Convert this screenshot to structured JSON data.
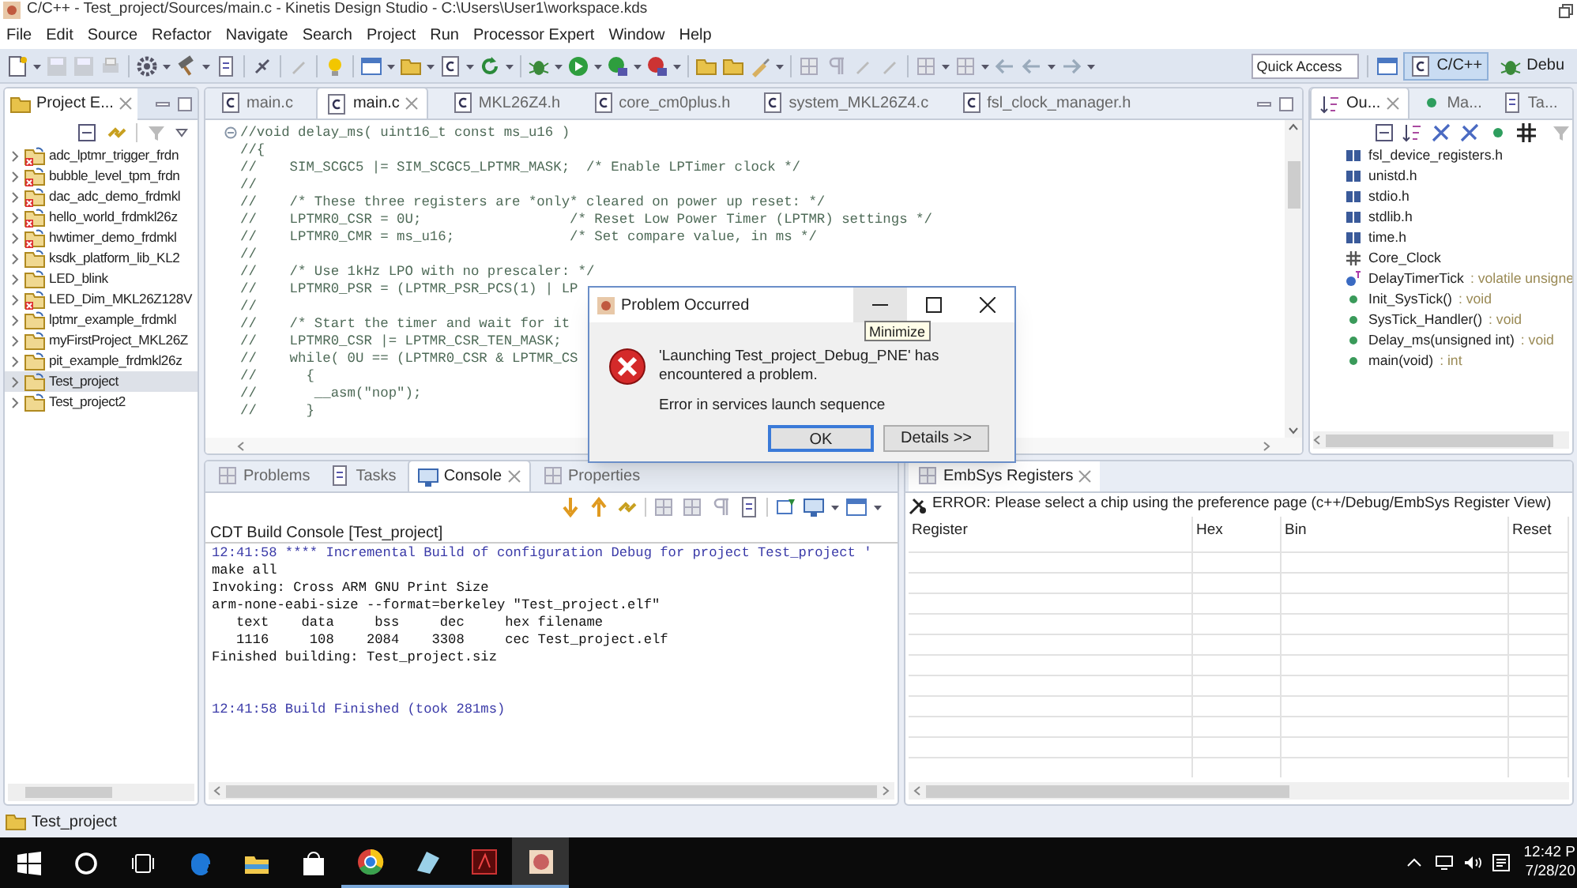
{
  "window": {
    "title": "C/C++ - Test_project/Sources/main.c - Kinetis Design Studio - C:\\Users\\User1\\workspace.kds"
  },
  "menu": [
    "File",
    "Edit",
    "Source",
    "Refactor",
    "Navigate",
    "Search",
    "Project",
    "Run",
    "Processor Expert",
    "Window",
    "Help"
  ],
  "toolbar": {
    "quick_access": {
      "placeholder": "Quick Access"
    },
    "perspectives": [
      {
        "label": "C/C++",
        "selected": true
      },
      {
        "label": "Debu",
        "selected": false
      }
    ]
  },
  "project_explorer": {
    "tab": "Project E...",
    "items": [
      {
        "label": "adc_lptmr_trigger_frdn",
        "error": true,
        "selected": false
      },
      {
        "label": "bubble_level_tpm_frdn",
        "error": true,
        "selected": false
      },
      {
        "label": "dac_adc_demo_frdmkl",
        "error": true,
        "selected": false
      },
      {
        "label": "hello_world_frdmkl26z",
        "error": true,
        "selected": false
      },
      {
        "label": "hwtimer_demo_frdmkl",
        "error": true,
        "selected": false
      },
      {
        "label": "ksdk_platform_lib_KL2",
        "error": false,
        "selected": false
      },
      {
        "label": "LED_blink",
        "error": false,
        "selected": false
      },
      {
        "label": "LED_Dim_MKL26Z128V",
        "error": true,
        "selected": false
      },
      {
        "label": "lptmr_example_frdmkl",
        "error": false,
        "selected": false
      },
      {
        "label": "myFirstProject_MKL26Z",
        "error": false,
        "selected": false
      },
      {
        "label": "pit_example_frdmkl26z",
        "error": false,
        "selected": false
      },
      {
        "label": "Test_project",
        "error": false,
        "selected": true
      },
      {
        "label": "Test_project2",
        "error": false,
        "selected": false
      }
    ]
  },
  "editor": {
    "tabs": [
      {
        "label": "main.c",
        "selected": false
      },
      {
        "label": "main.c",
        "selected": true
      },
      {
        "label": "MKL26Z4.h",
        "selected": false
      },
      {
        "label": "core_cm0plus.h",
        "selected": false
      },
      {
        "label": "system_MKL26Z4.c",
        "selected": false
      },
      {
        "label": "fsl_clock_manager.h",
        "selected": false
      }
    ],
    "lines": [
      "//void delay_ms( uint16_t const ms_u16 )",
      "//{",
      "//    SIM_SCGC5 |= SIM_SCGC5_LPTMR_MASK;  /* Enable LPTimer clock */",
      "//",
      "//    /* These three registers are *only* cleared on power up reset: */",
      "//    LPTMR0_CSR = 0U;                  /* Reset Low Power Timer (LPTMR) settings */",
      "//    LPTMR0_CMR = ms_u16;              /* Set compare value, in ms */",
      "//",
      "//    /* Use 1kHz LPO with no prescaler: */",
      "//    LPTMR0_PSR = (LPTMR_PSR_PCS(1) | LP",
      "//",
      "//    /* Start the timer and wait for it",
      "//    LPTMR0_CSR |= LPTMR_CSR_TEN_MASK;",
      "//    while( 0U == (LPTMR0_CSR & LPTMR_CS",
      "//      {",
      "//       __asm(\"nop\");",
      "//      }"
    ]
  },
  "outline": {
    "tabs": [
      {
        "label": "Ou...",
        "selected": true
      },
      {
        "label": "Ma...",
        "selected": false
      },
      {
        "label": "Ta...",
        "selected": false
      }
    ],
    "items": [
      {
        "kind": "include",
        "name": "fsl_device_registers.h"
      },
      {
        "kind": "include",
        "name": "unistd.h"
      },
      {
        "kind": "include",
        "name": "stdio.h"
      },
      {
        "kind": "include",
        "name": "stdlib.h"
      },
      {
        "kind": "include",
        "name": "time.h"
      },
      {
        "kind": "macro",
        "name": "Core_Clock"
      },
      {
        "kind": "variable",
        "name": "DelayTimerTick",
        "detail": ": volatile unsigne"
      },
      {
        "kind": "function",
        "name": "Init_SysTick()",
        "detail": ": void"
      },
      {
        "kind": "function",
        "name": "SysTick_Handler()",
        "detail": ": void"
      },
      {
        "kind": "function",
        "name": "Delay_ms(unsigned int)",
        "detail": ": void"
      },
      {
        "kind": "function",
        "name": "main(void)",
        "detail": ": int"
      }
    ]
  },
  "console": {
    "tabs": [
      {
        "label": "Problems",
        "selected": false
      },
      {
        "label": "Tasks",
        "selected": false
      },
      {
        "label": "Console",
        "selected": true
      },
      {
        "label": "Properties",
        "selected": false
      }
    ],
    "title": "CDT Build Console [Test_project]",
    "blocks": [
      {
        "lines": [
          {
            "kind": "info",
            "text": "12:41:58 **** Incremental Build of configuration Debug for project Test_project '"
          },
          {
            "kind": "output",
            "text": "make all"
          },
          {
            "kind": "output",
            "text": "Invoking: Cross ARM GNU Print Size"
          },
          {
            "kind": "output",
            "text": "arm-none-eabi-size --format=berkeley \"Test_project.elf\""
          },
          {
            "kind": "output",
            "text": "   text    data     bss     dec     hex filename"
          },
          {
            "kind": "output",
            "text": "   1116     108    2084    3308     cec Test_project.elf"
          },
          {
            "kind": "output",
            "text": "Finished building: Test_project.siz"
          }
        ]
      },
      {
        "lines": [
          {
            "kind": "info",
            "text": "12:41:58 Build Finished (took 281ms)"
          }
        ]
      }
    ]
  },
  "registers": {
    "tab": "EmbSys Registers",
    "error": "ERROR: Please select a chip using the preference page (c++/Debug/EmbSys Register View)",
    "columns": [
      "Register",
      "Hex",
      "Bin",
      "Reset"
    ]
  },
  "dialog": {
    "title": "Problem Occurred",
    "message": "'Launching Test_project_Debug_PNE' has encountered a problem.",
    "detail": "Error in services launch sequence",
    "buttons": [
      {
        "label": "OK",
        "default": true
      },
      {
        "label": "Details >>",
        "default": false
      }
    ],
    "tooltip": "Minimize"
  },
  "status_bar": {
    "text": "Test_project"
  },
  "taskbar": {
    "time": "12:42 P",
    "date": "7/28/20"
  }
}
